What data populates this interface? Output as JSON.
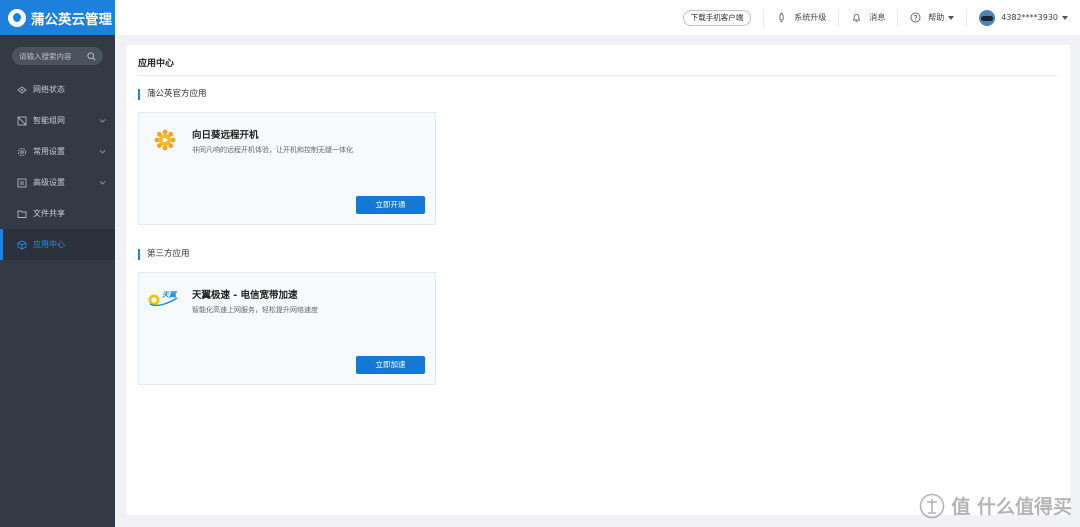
{
  "brand": {
    "title": "蒲公英云管理"
  },
  "search": {
    "placeholder": "请输入搜索内容"
  },
  "sidebar": {
    "items": [
      {
        "label": "网络状态",
        "icon": "network-icon"
      },
      {
        "label": "智能组网",
        "icon": "grid-icon"
      },
      {
        "label": "常用设置",
        "icon": "gear-icon"
      },
      {
        "label": "高级设置",
        "icon": "list-icon"
      },
      {
        "label": "文件共享",
        "icon": "folder-icon"
      },
      {
        "label": "应用中心",
        "icon": "cube-icon"
      }
    ]
  },
  "topbar": {
    "download_label": "下载手机客户端",
    "upgrade_label": "系统升级",
    "messages_label": "消息",
    "help_label": "帮助",
    "account_label": "4382****3930"
  },
  "main": {
    "title": "应用中心",
    "official_section": "蒲公英官方应用",
    "thirdparty_section": "第三方应用",
    "apps": [
      {
        "name": "向日葵远程开机",
        "desc": "非同凡响的远程开机体验，让开机和控制无缝一体化",
        "button": "立即开通"
      },
      {
        "name": "天翼极速 - 电信宽带加速",
        "desc": "智能化高速上网服务，轻松提升网络速度",
        "button": "立即加速",
        "logo_text": "天翼"
      }
    ]
  },
  "watermark": {
    "text": "值 什么值得买"
  },
  "colors": {
    "accent": "#1e80dd",
    "sidebar_bg": "#333a45",
    "button": "#1479d4"
  }
}
